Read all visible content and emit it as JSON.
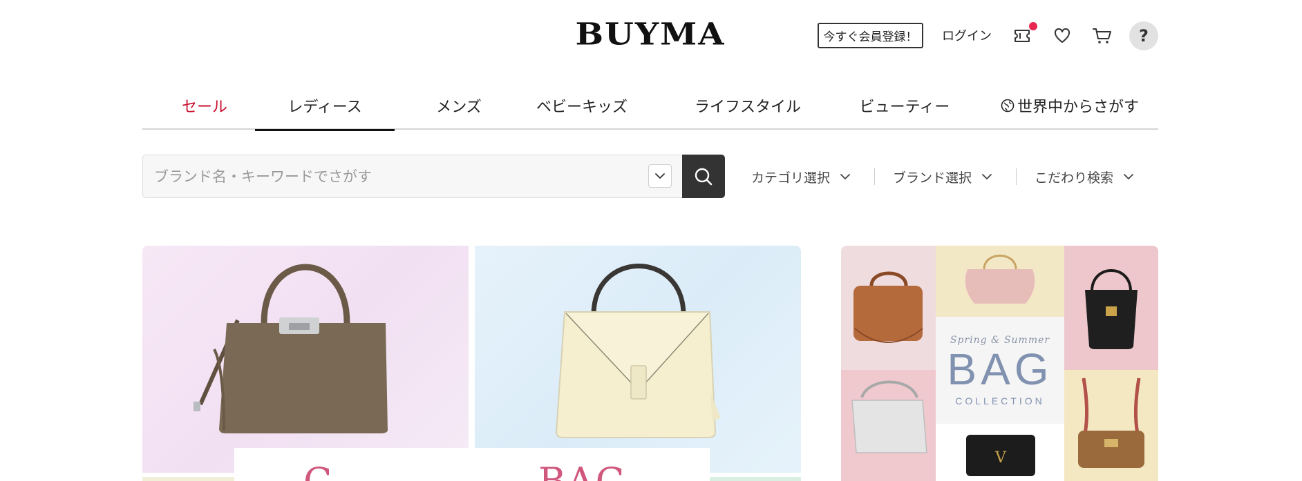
{
  "header": {
    "logo": "BUYMA",
    "register_label": "今すぐ会員登録！",
    "login_label": "ログイン",
    "icons": [
      "coupon-icon",
      "heart-icon",
      "cart-icon",
      "help-icon"
    ],
    "help_label": "?",
    "notification_color": "#e8264f"
  },
  "nav": {
    "items": [
      {
        "label": "セール",
        "color": "#c8102e"
      },
      {
        "label": "レディース",
        "active": true
      },
      {
        "label": "メンズ"
      },
      {
        "label": "ベビーキッズ"
      },
      {
        "label": "ライフスタイル"
      },
      {
        "label": "ビューティー"
      },
      {
        "label": "世界中からさがす",
        "icon": "globe-icon"
      }
    ]
  },
  "search": {
    "placeholder": "ブランド名・キーワードでさがす",
    "value": ""
  },
  "filters": [
    {
      "label": "カテゴリ選択"
    },
    {
      "label": "ブランド選択"
    },
    {
      "label": "こだわり検索"
    }
  ],
  "banners": {
    "left": {
      "headline_left": "C",
      "headline_right": "BAG"
    },
    "right": {
      "script": "Spring & Summer",
      "title": "BAG",
      "subtitle": "COLLECTION"
    }
  }
}
